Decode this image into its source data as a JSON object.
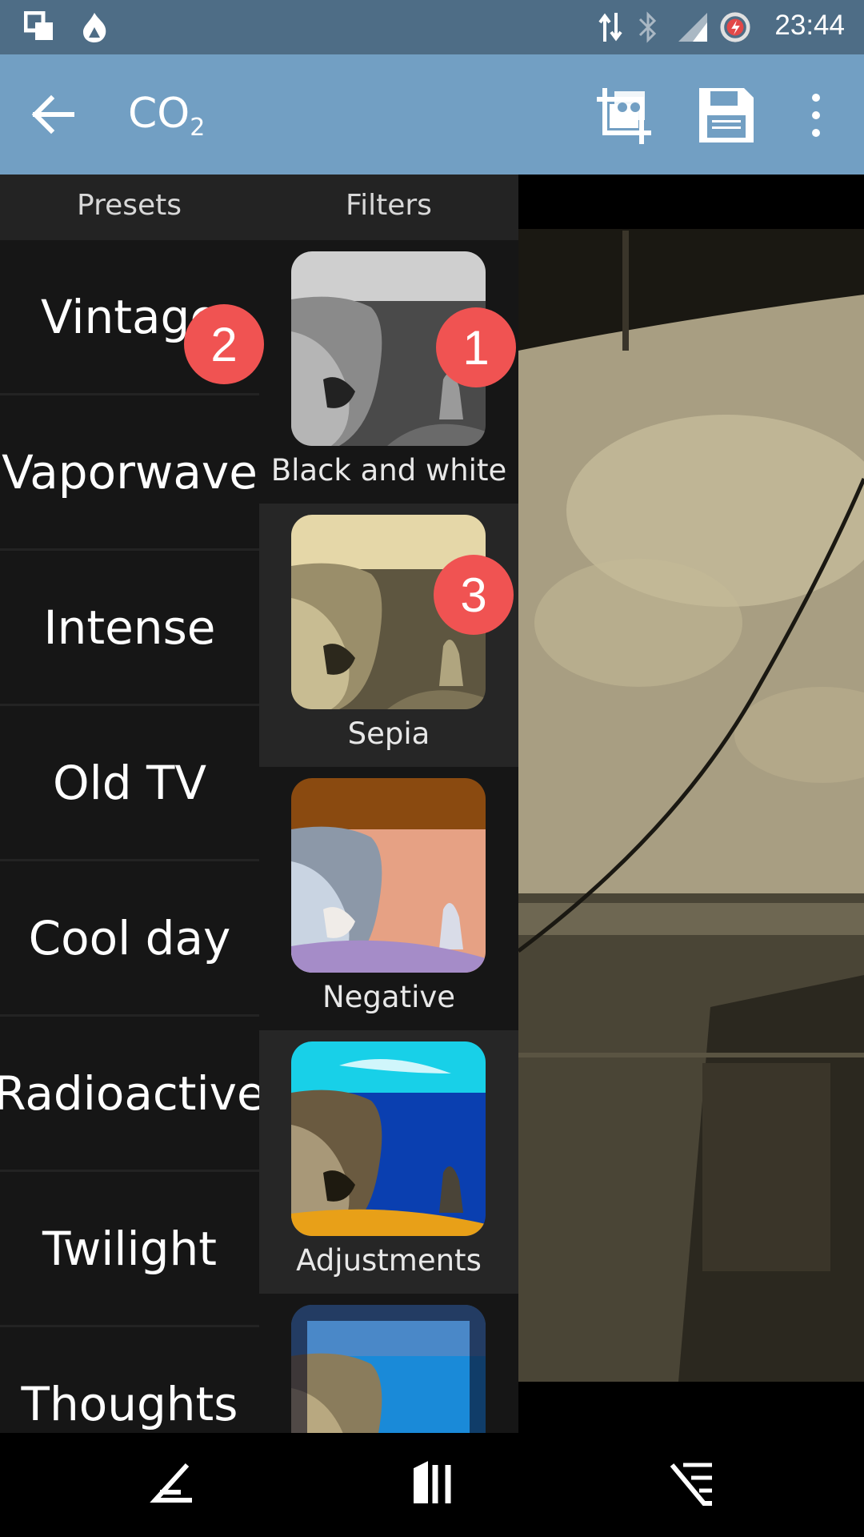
{
  "status_bar": {
    "time": "23:44",
    "icons": [
      "window-icon",
      "fire-icon",
      "data-arrows-icon",
      "bluetooth-icon",
      "signal-icon",
      "battery-saver-icon"
    ]
  },
  "app_bar": {
    "title_main": "CO",
    "title_sub": "2",
    "actions": [
      "back-arrow-icon",
      "crop-image-icon",
      "save-icon",
      "more-vert-icon"
    ]
  },
  "tabs": {
    "presets": "Presets",
    "filters": "Filters"
  },
  "presets": [
    "Vintage",
    "Vaporwave",
    "Intense",
    "Old TV",
    "Cool day",
    "Radioactive",
    "Twilight",
    "Thoughts"
  ],
  "filters": [
    {
      "label": "Black and white"
    },
    {
      "label": "Sepia"
    },
    {
      "label": "Negative"
    },
    {
      "label": "Adjustments"
    },
    {
      "label": ""
    }
  ],
  "badges": [
    "1",
    "2",
    "3"
  ],
  "colors": {
    "status_bar": "#4e6d86",
    "app_bar": "#729fc3",
    "badge": "#f05352",
    "drawer": "#161616"
  },
  "nav_bar": [
    "back-nav-icon",
    "home-nav-icon",
    "recents-nav-icon"
  ]
}
